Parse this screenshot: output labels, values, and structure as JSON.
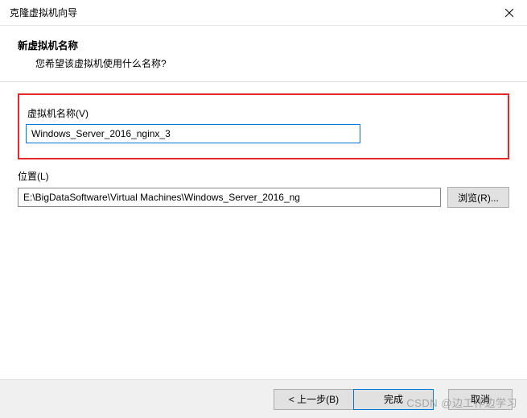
{
  "window": {
    "title": "克隆虚拟机向导"
  },
  "header": {
    "title": "新虚拟机名称",
    "subtitle": "您希望该虚拟机使用什么名称?"
  },
  "name_field": {
    "label": "虚拟机名称(V)",
    "value": "Windows_Server_2016_nginx_3"
  },
  "location_field": {
    "label": "位置(L)",
    "value": "E:\\BigDataSoftware\\Virtual Machines\\Windows_Server_2016_ng",
    "browse_label": "浏览(R)..."
  },
  "footer": {
    "back_label": "< 上一步(B)",
    "finish_label": "完成",
    "cancel_label": "取消"
  },
  "watermark": "CSDN @边工作边学习"
}
